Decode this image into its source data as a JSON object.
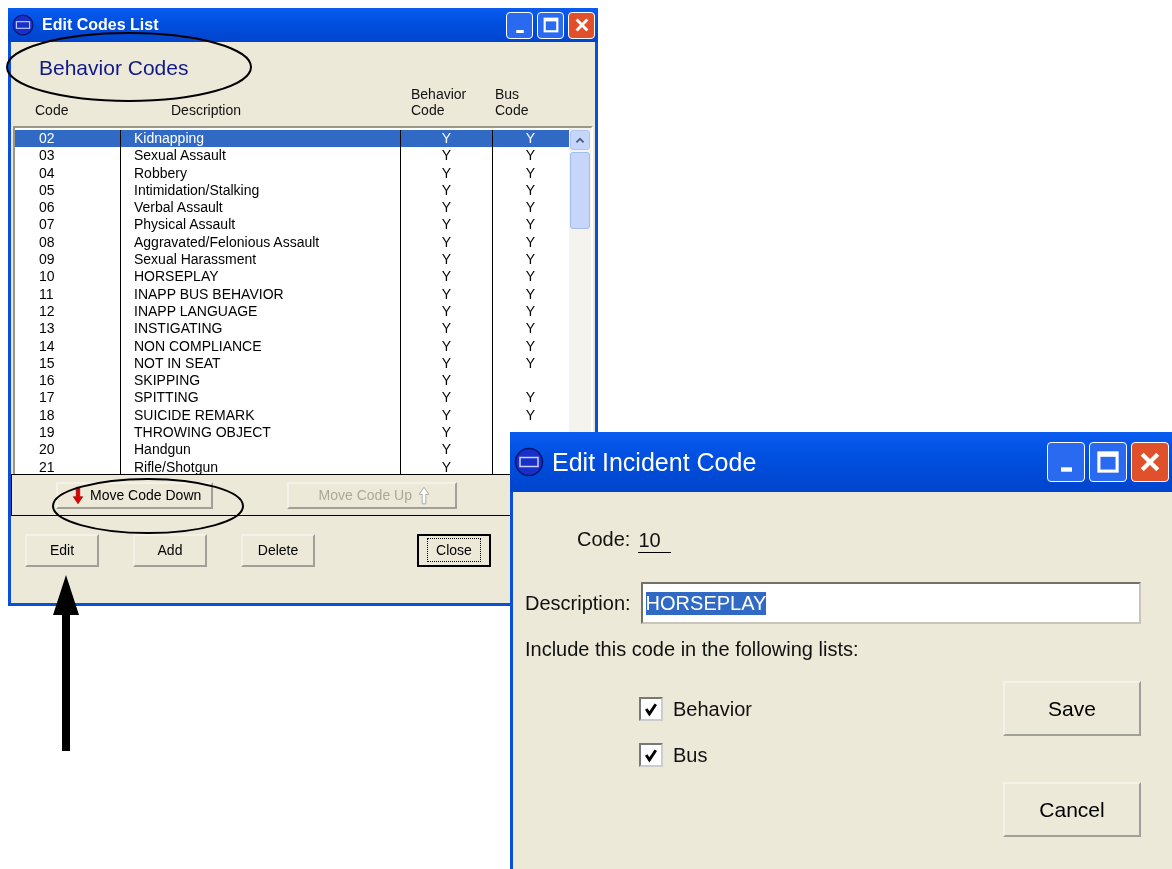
{
  "list_window": {
    "title": "Edit Codes List",
    "heading": "Behavior Codes",
    "columns": [
      "Code",
      "Description",
      "Behavior Code",
      "Bus Code"
    ],
    "rows": [
      {
        "code": "02",
        "description": "Kidnapping",
        "behavior": "Y",
        "bus": "Y",
        "selected": true
      },
      {
        "code": "03",
        "description": "Sexual Assault",
        "behavior": "Y",
        "bus": "Y",
        "selected": false
      },
      {
        "code": "04",
        "description": "Robbery",
        "behavior": "Y",
        "bus": "Y",
        "selected": false
      },
      {
        "code": "05",
        "description": "Intimidation/Stalking",
        "behavior": "Y",
        "bus": "Y",
        "selected": false
      },
      {
        "code": "06",
        "description": "Verbal Assault",
        "behavior": "Y",
        "bus": "Y",
        "selected": false
      },
      {
        "code": "07",
        "description": "Physical Assault",
        "behavior": "Y",
        "bus": "Y",
        "selected": false
      },
      {
        "code": "08",
        "description": "Aggravated/Felonious Assault",
        "behavior": "Y",
        "bus": "Y",
        "selected": false
      },
      {
        "code": "09",
        "description": "Sexual Harassment",
        "behavior": "Y",
        "bus": "Y",
        "selected": false
      },
      {
        "code": "10",
        "description": "HORSEPLAY",
        "behavior": "Y",
        "bus": "Y",
        "selected": false
      },
      {
        "code": "11",
        "description": "INAPP BUS BEHAVIOR",
        "behavior": "Y",
        "bus": "Y",
        "selected": false
      },
      {
        "code": "12",
        "description": "INAPP LANGUAGE",
        "behavior": "Y",
        "bus": "Y",
        "selected": false
      },
      {
        "code": "13",
        "description": "INSTIGATING",
        "behavior": "Y",
        "bus": "Y",
        "selected": false
      },
      {
        "code": "14",
        "description": "NON COMPLIANCE",
        "behavior": "Y",
        "bus": "Y",
        "selected": false
      },
      {
        "code": "15",
        "description": "NOT IN SEAT",
        "behavior": "Y",
        "bus": "Y",
        "selected": false
      },
      {
        "code": "16",
        "description": "SKIPPING",
        "behavior": "Y",
        "selected": false
      },
      {
        "code": "17",
        "description": "SPITTING",
        "behavior": "Y",
        "bus": "Y",
        "selected": false
      },
      {
        "code": "18",
        "description": "SUICIDE REMARK",
        "behavior": "Y",
        "bus": "Y",
        "selected": false
      },
      {
        "code": "19",
        "description": "THROWING OBJECT",
        "behavior": "Y",
        "selected": false
      },
      {
        "code": "20",
        "description": "Handgun",
        "behavior": "Y",
        "selected": false
      },
      {
        "code": "21",
        "description": "Rifle/Shotgun",
        "behavior": "Y",
        "selected": false
      }
    ],
    "move_buttons": [
      {
        "label": "Move Code Down",
        "kind": "down",
        "disabled": false
      },
      {
        "label": "Move Code Up",
        "kind": "up",
        "disabled": true
      }
    ],
    "buttons": [
      {
        "label": "Edit",
        "default": false
      },
      {
        "label": "Add",
        "default": false
      },
      {
        "label": "Delete",
        "default": false
      },
      {
        "label": "Close",
        "default": true
      }
    ]
  },
  "edit_dialog": {
    "title": "Edit Incident Code",
    "code_label": "Code:",
    "code_value": "10",
    "description_label": "Description:",
    "description_value": "HORSEPLAY",
    "description_selected": true,
    "include_label": "Include this code in the following lists:",
    "checkboxes": [
      {
        "label": "Behavior",
        "checked": true
      },
      {
        "label": "Bus",
        "checked": true
      }
    ],
    "buttons": [
      "Save",
      "Cancel"
    ]
  }
}
